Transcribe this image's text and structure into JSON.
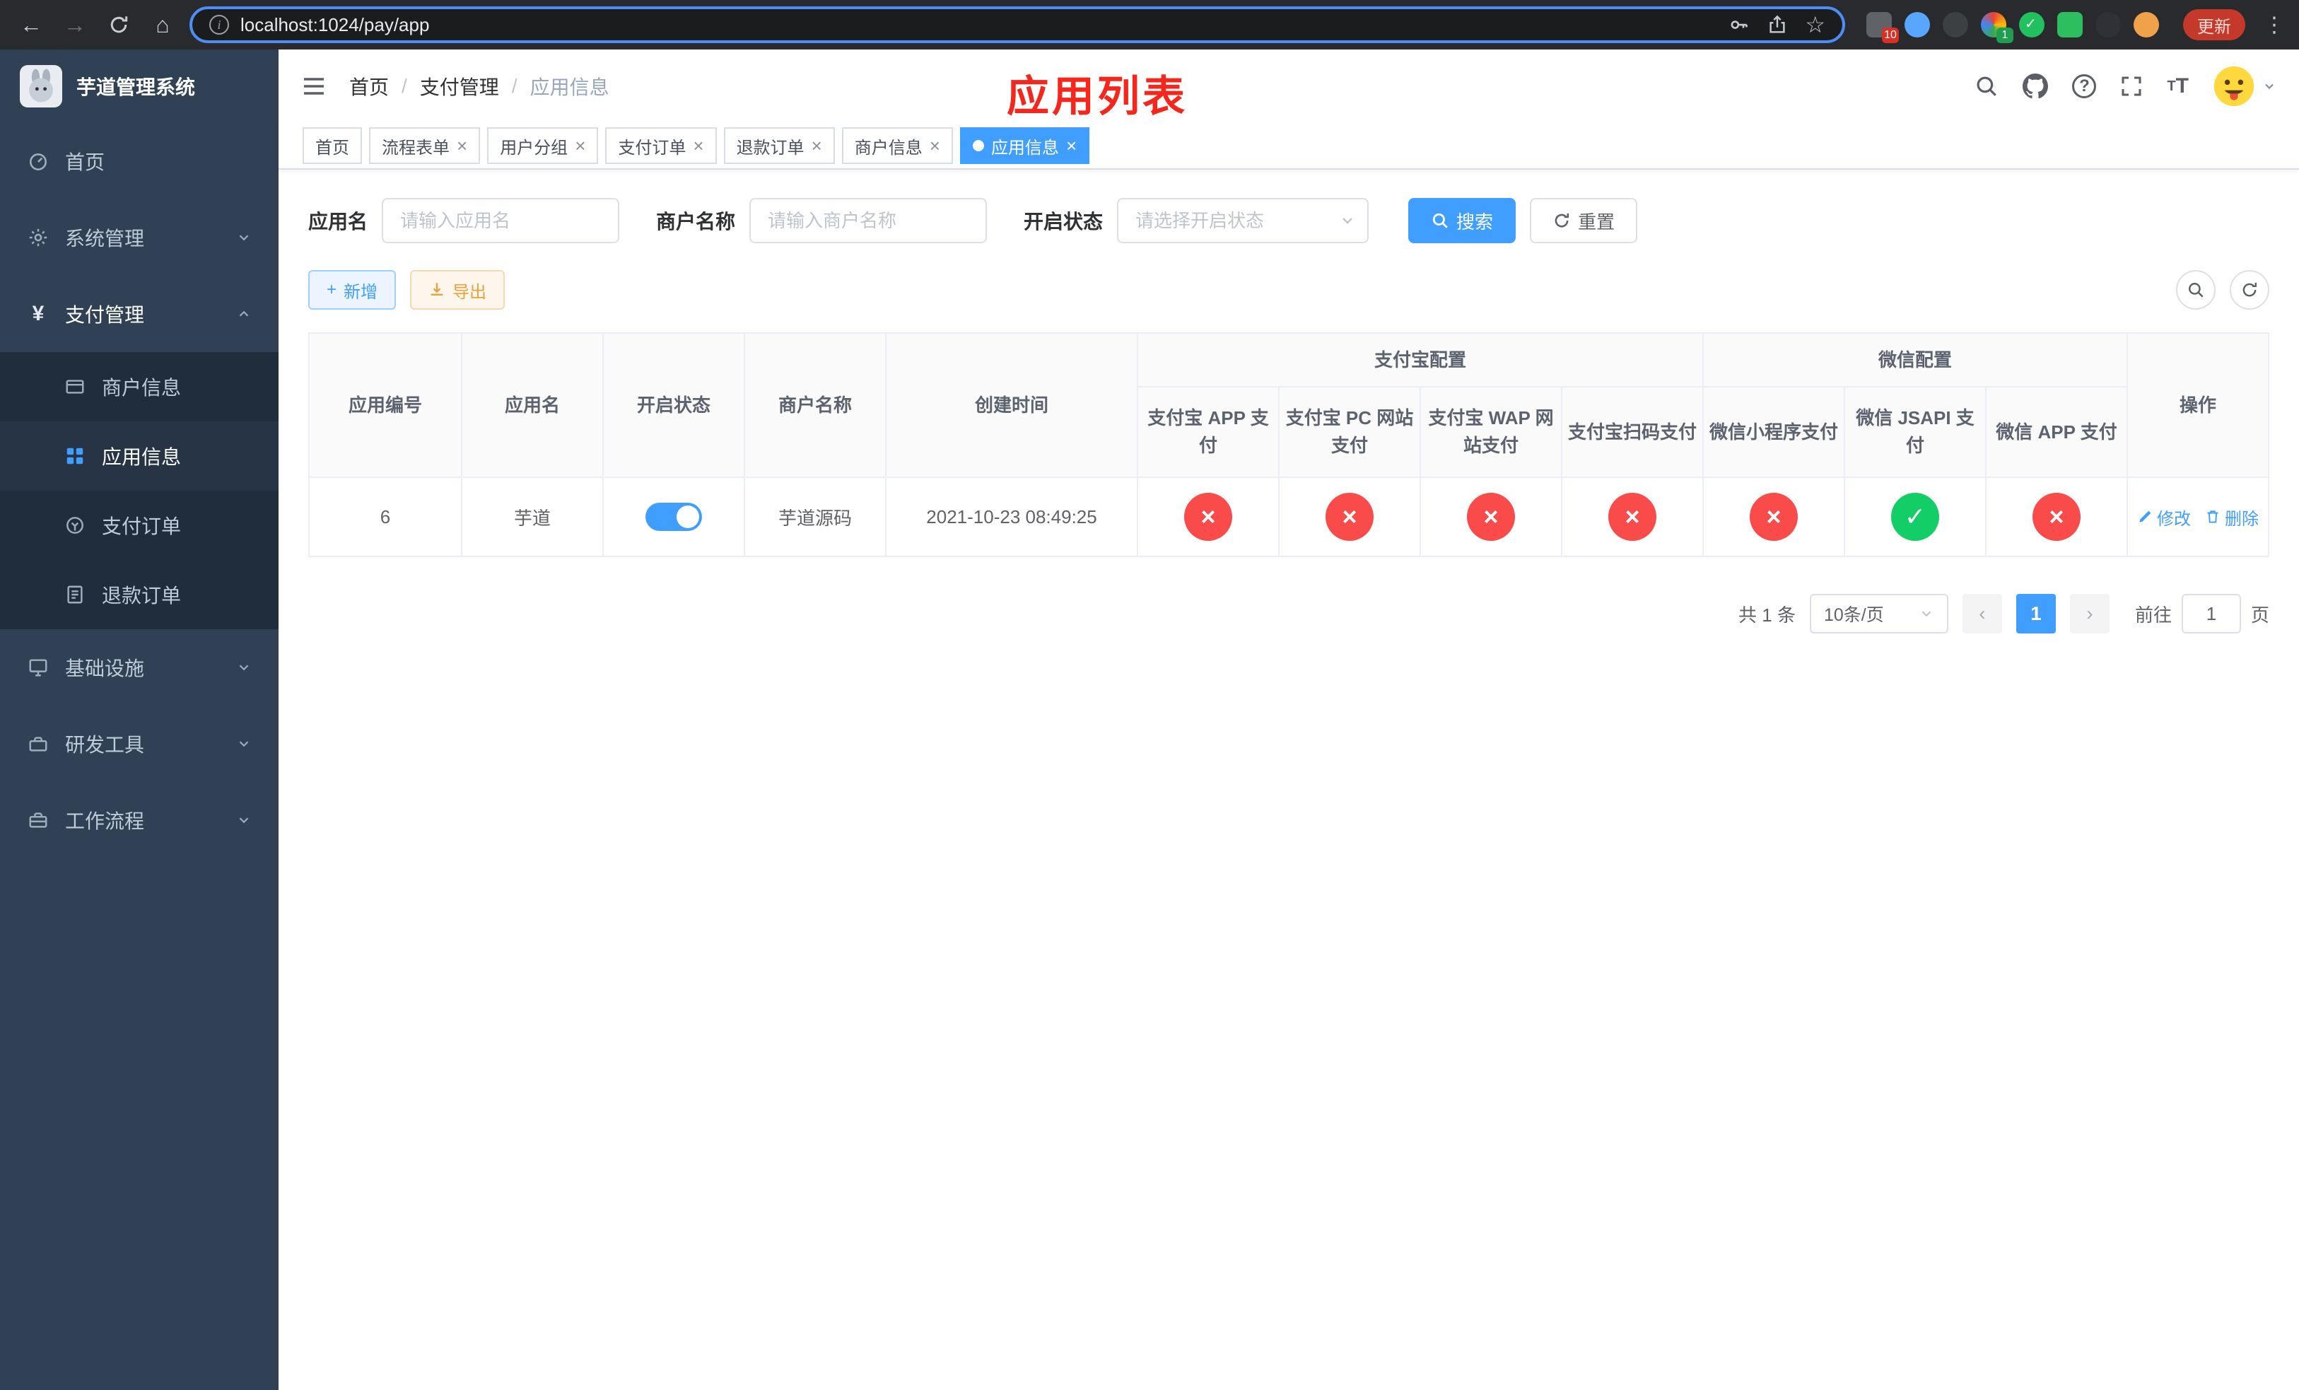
{
  "colors": {
    "accent": "#409eff",
    "success": "#13ce66",
    "danger": "#fa4b4b",
    "warning": "#e6a23c",
    "sidebar_bg": "#304156",
    "sidebar_sub_bg": "#1f2d3d",
    "tab_active": "#409eff",
    "overlay_title_red": "#f5271d"
  },
  "browser": {
    "url": "localhost:1024/pay/app",
    "update_label": "更新",
    "ext_badge_puzzle": "10",
    "ext_badge_colorful": "1"
  },
  "sidebar": {
    "title": "芋道管理系统",
    "items": [
      {
        "label": "首页"
      },
      {
        "label": "系统管理"
      },
      {
        "label": "支付管理"
      },
      {
        "label": "基础设施"
      },
      {
        "label": "研发工具"
      },
      {
        "label": "工作流程"
      }
    ],
    "payment_children": [
      {
        "label": "商户信息"
      },
      {
        "label": "应用信息"
      },
      {
        "label": "支付订单"
      },
      {
        "label": "退款订单"
      }
    ]
  },
  "header": {
    "breadcrumb": [
      "首页",
      "支付管理",
      "应用信息"
    ],
    "overlay_title": "应用列表"
  },
  "tabs": [
    {
      "label": "首页"
    },
    {
      "label": "流程表单"
    },
    {
      "label": "用户分组"
    },
    {
      "label": "支付订单"
    },
    {
      "label": "退款订单"
    },
    {
      "label": "商户信息"
    },
    {
      "label": "应用信息"
    }
  ],
  "filters": {
    "app_name_label": "应用名",
    "app_name_placeholder": "请输入应用名",
    "merchant_label": "商户名称",
    "merchant_placeholder": "请输入商户名称",
    "status_label": "开启状态",
    "status_placeholder": "请选择开启状态",
    "search_label": "搜索",
    "reset_label": "重置"
  },
  "actions": {
    "add_label": "新增",
    "export_label": "导出"
  },
  "table": {
    "columns": [
      "应用编号",
      "应用名",
      "开启状态",
      "商户名称",
      "创建时间"
    ],
    "group_alipay": "支付宝配置",
    "group_wechat": "微信配置",
    "op_header": "操作",
    "alipay_columns": [
      "支付宝 APP 支付",
      "支付宝 PC 网站支付",
      "支付宝 WAP 网站支付",
      "支付宝扫码支付"
    ],
    "wechat_columns": [
      "微信小程序支付",
      "微信 JSAPI 支付",
      "微信 APP 支付"
    ],
    "row": {
      "app_id": "6",
      "app_name": "芋道",
      "status_on": true,
      "merchant_name": "芋道源码",
      "created_at": "2021-10-23 08:49:25",
      "channel_status": [
        "no",
        "no",
        "no",
        "no",
        "no",
        "yes",
        "no"
      ],
      "edit_label": "修改",
      "delete_label": "删除"
    }
  },
  "pagination": {
    "total_label": "共 1 条",
    "page_size_label": "10条/页",
    "current_page": "1",
    "goto_label": "前往",
    "goto_value": "1",
    "goto_suffix": "页"
  }
}
